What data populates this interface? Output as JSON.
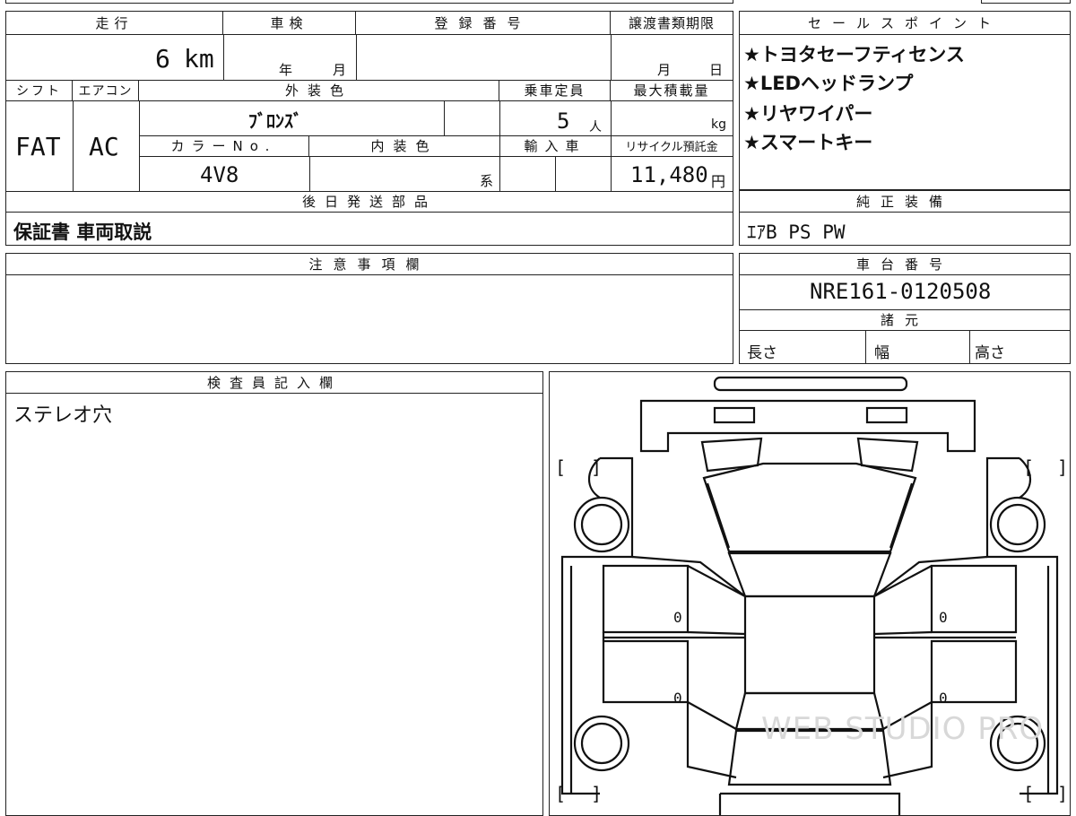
{
  "info": {
    "headers": {
      "mileage": "走行",
      "inspection": "車検",
      "registration_no": "登録番号",
      "transfer_deadline": "譲渡書類期限",
      "shift": "シフト",
      "aircon": "エアコン",
      "exterior_color": "外装色",
      "capacity": "乗車定員",
      "max_load": "最大積載量",
      "color_no": "カラーNo.",
      "interior_color": "内装色",
      "import": "輸入車",
      "recycle": "リサイクル預託金",
      "later_parts": "後日発送部品"
    },
    "mileage_value": "6",
    "mileage_unit": "km",
    "inspection_year": "年",
    "inspection_month": "月",
    "transfer_month": "月",
    "transfer_day": "日",
    "shift_value": "FAT",
    "aircon_value": "AC",
    "exterior_color_value": "ﾌﾞﾛﾝｽﾞ",
    "capacity_value": "5",
    "capacity_unit": "人",
    "max_load_unit": "kg",
    "color_no_value": "4V8",
    "interior_suffix": "系",
    "recycle_value": "11,480",
    "recycle_unit": "円",
    "later_parts_value": "保証書 車両取説"
  },
  "sales_points": {
    "header": "セールスポイント",
    "items": [
      "★トヨタセーフティセンス",
      "★LEDヘッドランプ",
      "★リヤワイパー",
      "★スマートキー"
    ]
  },
  "genuine_equipment": {
    "header": "純正装備",
    "value": "ｴｱB PS PW"
  },
  "notes": {
    "header": "注意事項欄",
    "value": ""
  },
  "chassis": {
    "header": "車台番号",
    "value": "NRE161-0120508"
  },
  "specs": {
    "header": "諸元",
    "length": "長さ",
    "width": "幅",
    "height": "高さ"
  },
  "inspector": {
    "header": "検査員記入欄",
    "value": "ステレオ穴"
  },
  "diagram": {
    "bracket_open": "[",
    "bracket_close": "]",
    "door_marks": [
      "0",
      "0",
      "0",
      "0"
    ],
    "watermark": "WEB STUDIO PRO"
  }
}
